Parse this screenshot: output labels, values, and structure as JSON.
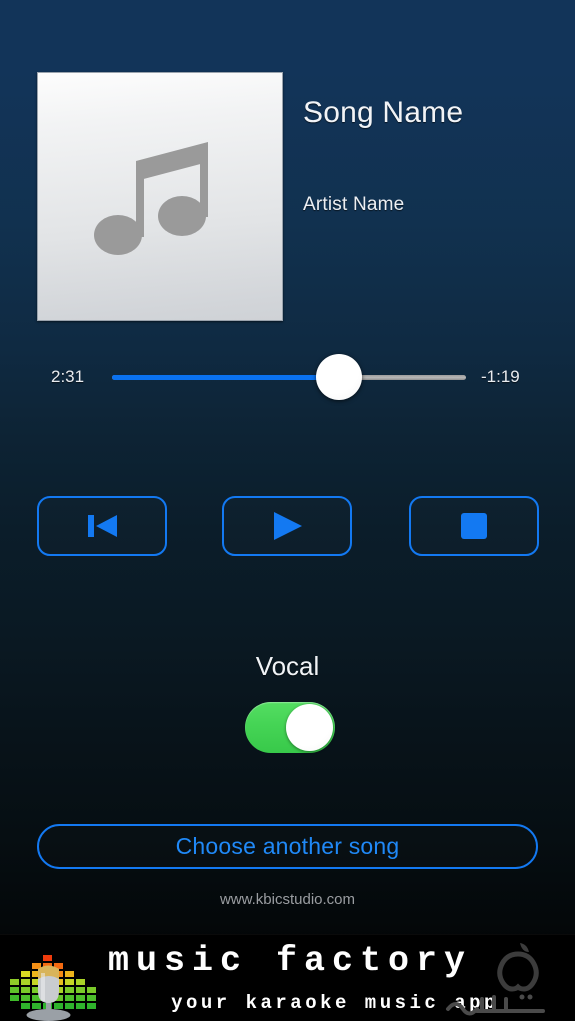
{
  "theme": {
    "bg_top": "#123459",
    "bg_bottom": "#000000",
    "accent_blue": "#1379f2",
    "progress_blue": "#0a72f0",
    "toggle_green": "#45d455",
    "text_primary": "#f2f4f7",
    "text_muted": "#9a9da1",
    "banner_bg": "#000000"
  },
  "now_playing": {
    "album_art_icon": "music-note-icon",
    "song_title": "Song Name",
    "artist": "Artist Name"
  },
  "scrubber": {
    "elapsed": "2:31",
    "remaining": "-1:19",
    "progress_percent": 64,
    "thumb_icon": "slider-thumb"
  },
  "transport": {
    "previous": {
      "label": "Previous",
      "icon": "previous-track-icon"
    },
    "play": {
      "label": "Play",
      "icon": "play-icon"
    },
    "stop": {
      "label": "Stop",
      "icon": "stop-icon"
    }
  },
  "vocal": {
    "label": "Vocal",
    "state": "on"
  },
  "choose_song": {
    "label": "Choose another song"
  },
  "footer": {
    "website": "www.kbicstudio.com"
  },
  "ad_banner": {
    "title": "music factory",
    "subtitle": "your karaoke music app",
    "icon": "microphone-equalizer-icon",
    "apple_logo": "apple-logo-icon",
    "watermark": "sibapp-watermark"
  }
}
